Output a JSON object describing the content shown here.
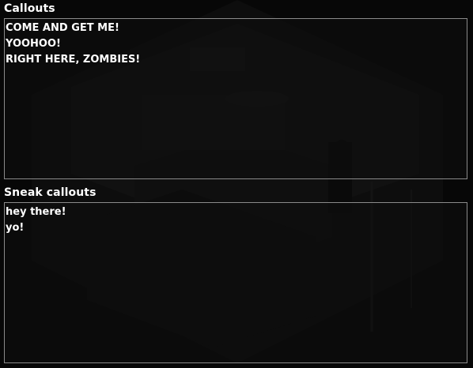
{
  "callouts": {
    "label": "Callouts",
    "lines": [
      "COME AND GET ME!",
      "YOOHOO!",
      "RIGHT HERE, ZOMBIES!"
    ]
  },
  "sneak_callouts": {
    "label": "Sneak callouts",
    "lines": [
      "hey there!",
      "yo!"
    ]
  },
  "colors": {
    "background": "#070707",
    "text": "#ffffff",
    "field_border": "#8a8a8a"
  }
}
